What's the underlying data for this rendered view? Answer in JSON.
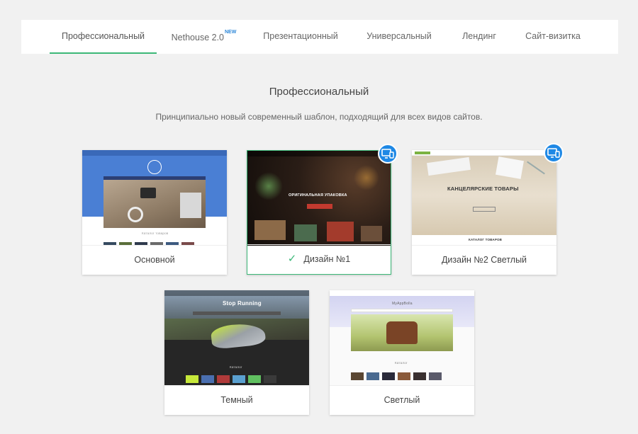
{
  "tabs": [
    {
      "label": "Профессиональный",
      "active": true
    },
    {
      "label": "Nethouse 2.0",
      "badge": "NEW"
    },
    {
      "label": "Презентационный"
    },
    {
      "label": "Универсальный"
    },
    {
      "label": "Лендинг"
    },
    {
      "label": "Сайт-визитка"
    }
  ],
  "section": {
    "title": "Профессиональный",
    "description": "Принципиально новый современный шаблон, подходящий для всех видов сайтов."
  },
  "templates": [
    {
      "name": "Основной",
      "mini_caption": "Каталог товаров"
    },
    {
      "name": "Дизайн №1",
      "selected": true,
      "adaptive_icon": "monitor-phone-icon",
      "mini_headline": "ОРИГИНАЛЬНАЯ УПАКОВКА",
      "mini_button": "СМОТРЕТЬ КАТАЛОГ"
    },
    {
      "name": "Дизайн №2 Светлый",
      "adaptive_icon": "monitor-phone-icon",
      "mini_headline": "КАНЦЕЛЯРСКИЕ ТОВАРЫ",
      "mini_caption": "КАТАЛОГ ТОВАРОВ"
    },
    {
      "name": "Темный",
      "mini_headline": "Stop Running",
      "mini_caption": "Каталог"
    },
    {
      "name": "Светлый",
      "mini_logo": "MyAppBolla",
      "mini_caption": "Каталог"
    }
  ],
  "colors": {
    "accent_green": "#3cb878",
    "badge_blue": "#1e88e5",
    "new_badge": "#2d87d8",
    "page_bg": "#f1f1f1"
  }
}
